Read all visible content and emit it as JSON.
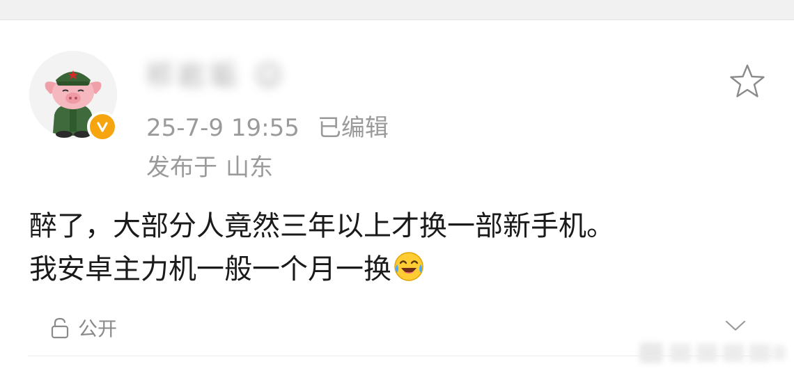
{
  "post": {
    "author": {
      "name_obscured": "祁岩垢  ☺",
      "verified_badge": "V"
    },
    "timestamp": "25-7-9 19:55",
    "edited_label": "已编辑",
    "location_prefix": "发布于",
    "location": "山东",
    "content_lines": [
      "醉了，大部分人竟然三年以上才换一部新手机。",
      "我安卓主力机一般一个月一换"
    ],
    "content_emoji": "laughing-crying-emoji",
    "visibility_label": "公开"
  },
  "icons": {
    "star": "star-outline-icon",
    "lock": "unlock-icon",
    "chevron": "chevron-down-icon"
  },
  "colors": {
    "meta_text": "#9a9a9a",
    "content_text": "#1a1a1a",
    "verified_badge": "#f6a50e",
    "icon_gray": "#8a8a8a"
  }
}
